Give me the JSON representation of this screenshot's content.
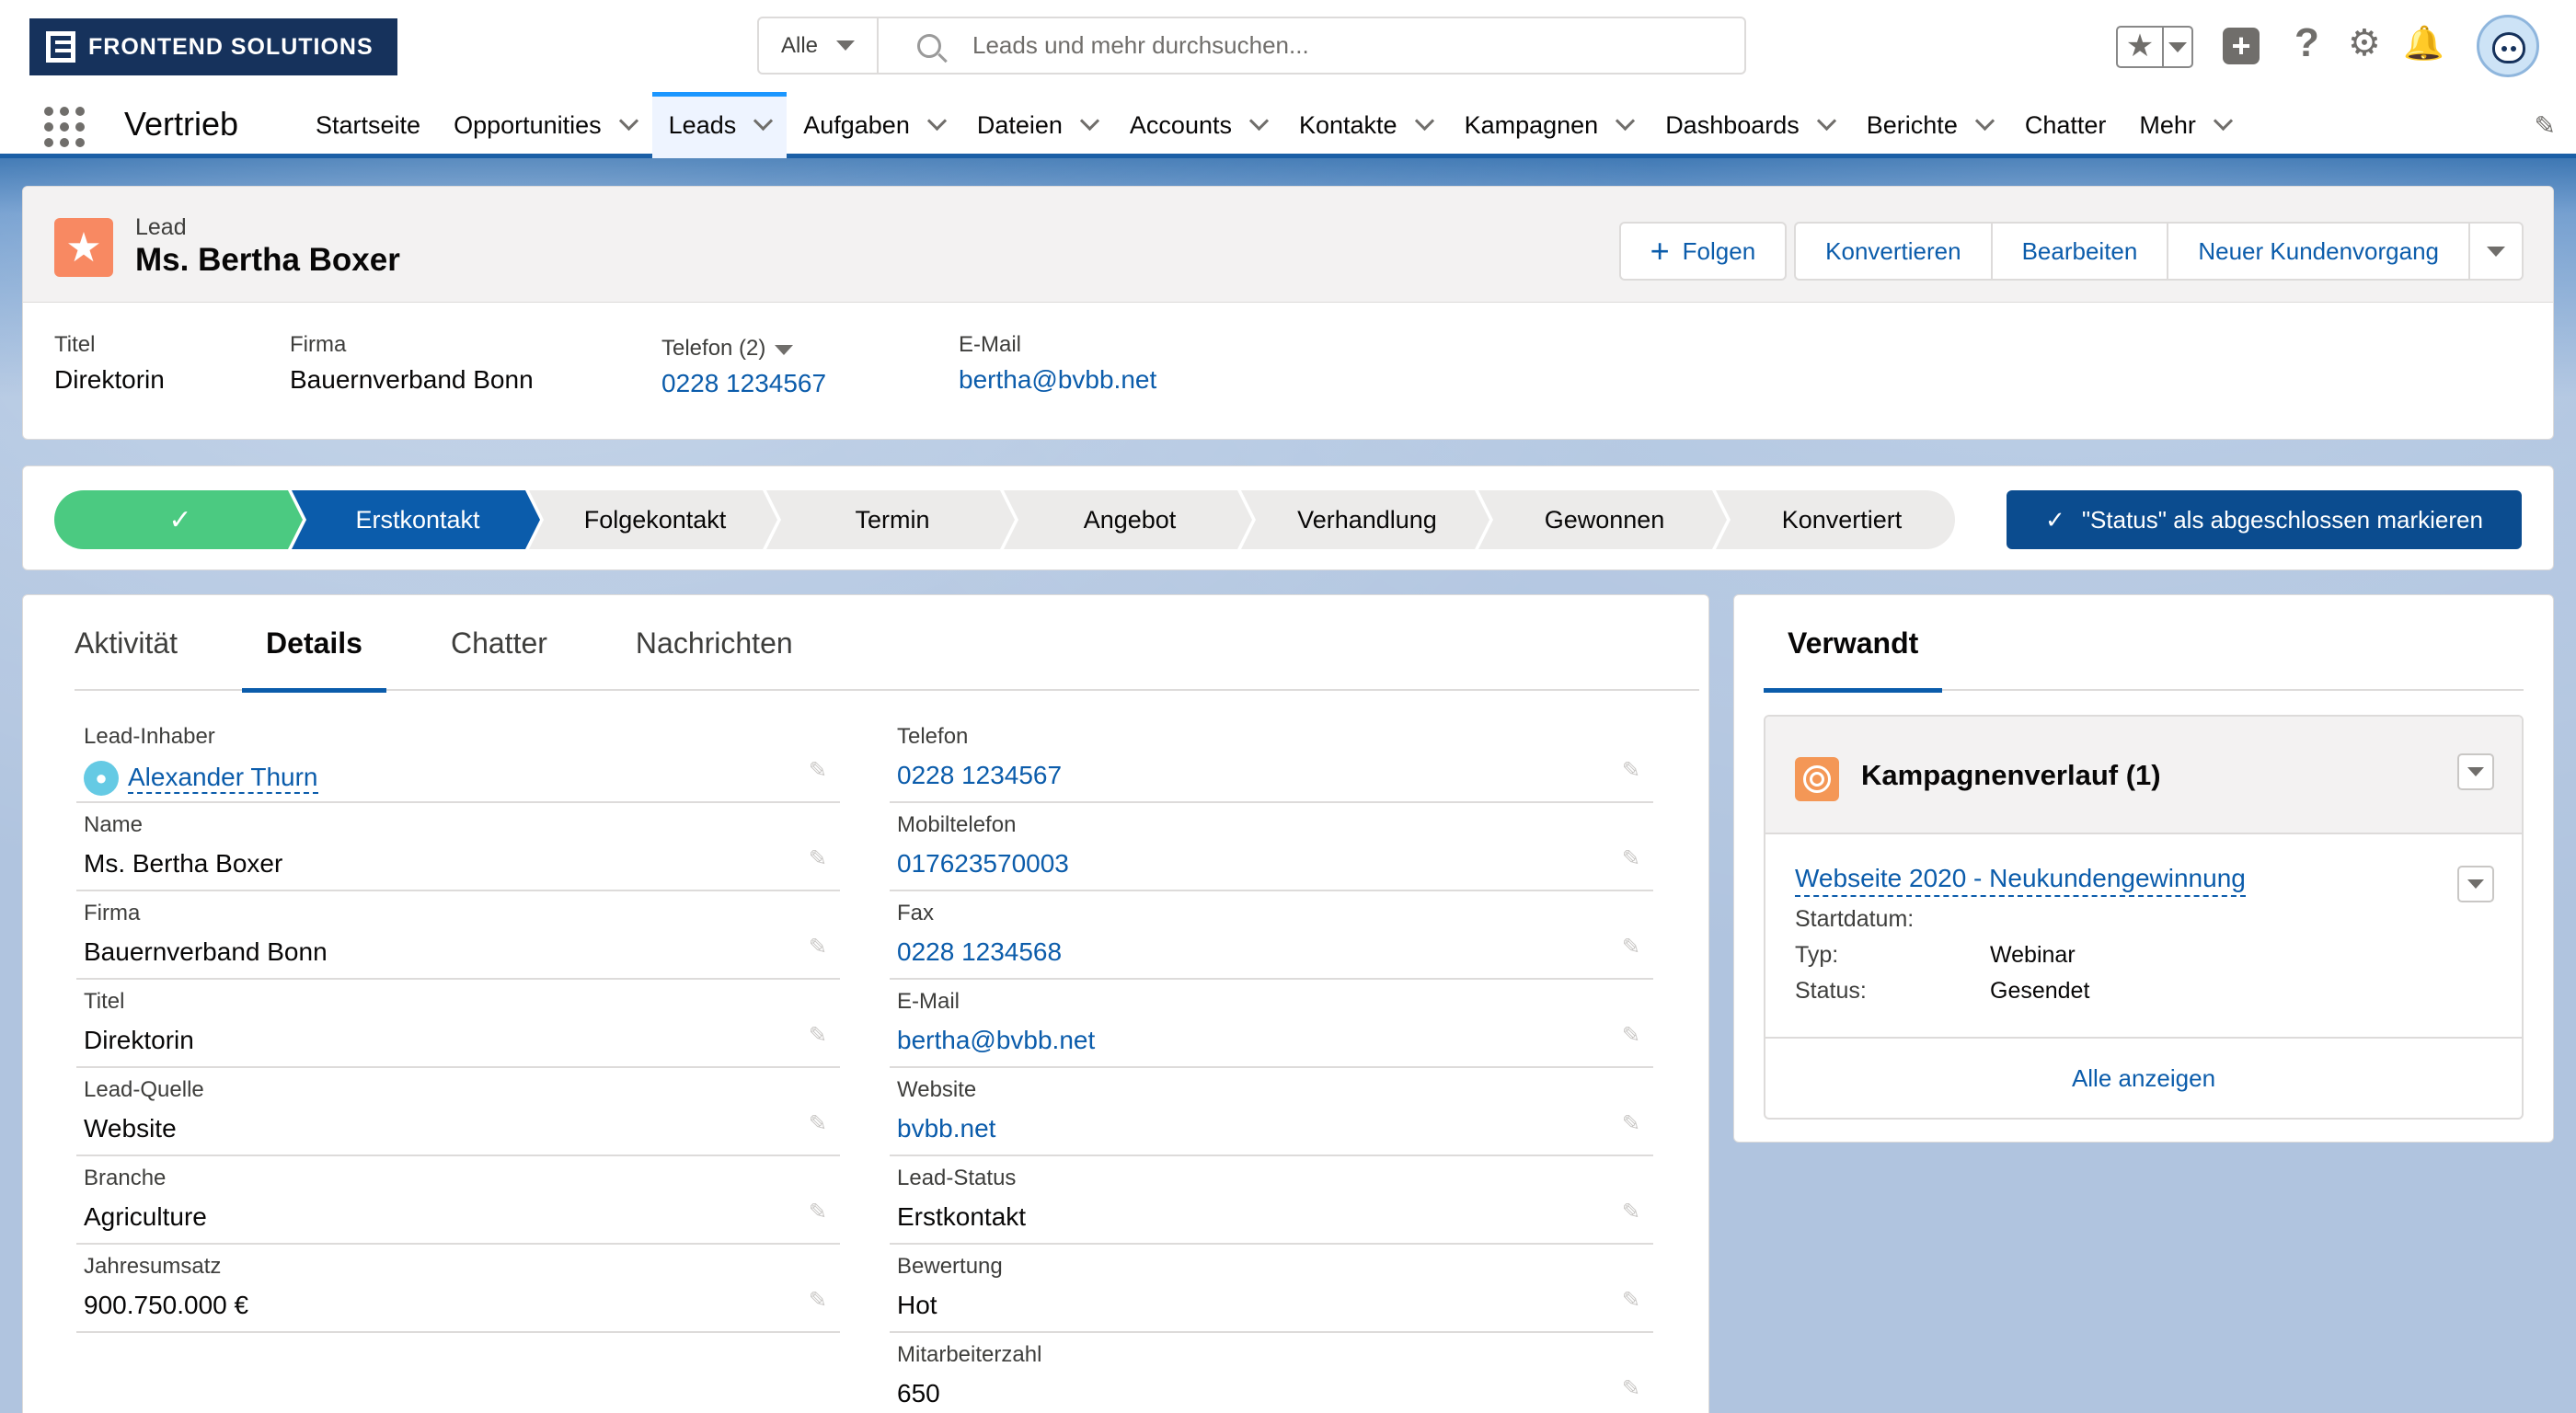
{
  "header": {
    "logo_text": "FRONTEND SOLUTIONS",
    "search_scope": "Alle",
    "search_placeholder": "Leads und mehr durchsuchen..."
  },
  "nav": {
    "app_name": "Vertrieb",
    "items": [
      {
        "label": "Startseite",
        "dropdown": false,
        "active": false
      },
      {
        "label": "Opportunities",
        "dropdown": true,
        "active": false
      },
      {
        "label": "Leads",
        "dropdown": true,
        "active": true
      },
      {
        "label": "Aufgaben",
        "dropdown": true,
        "active": false
      },
      {
        "label": "Dateien",
        "dropdown": true,
        "active": false
      },
      {
        "label": "Accounts",
        "dropdown": true,
        "active": false
      },
      {
        "label": "Kontakte",
        "dropdown": true,
        "active": false
      },
      {
        "label": "Kampagnen",
        "dropdown": true,
        "active": false
      },
      {
        "label": "Dashboards",
        "dropdown": true,
        "active": false
      },
      {
        "label": "Berichte",
        "dropdown": true,
        "active": false
      },
      {
        "label": "Chatter",
        "dropdown": false,
        "active": false
      },
      {
        "label": "Mehr",
        "dropdown": true,
        "active": false
      }
    ]
  },
  "record": {
    "entity": "Lead",
    "name": "Ms. Bertha Boxer",
    "actions": {
      "follow": "Folgen",
      "convert": "Konvertieren",
      "edit": "Bearbeiten",
      "new_case": "Neuer Kundenvorgang"
    },
    "highlights": [
      {
        "label": "Titel",
        "value": "Direktorin",
        "link": false
      },
      {
        "label": "Firma",
        "value": "Bauernverband Bonn",
        "link": false
      },
      {
        "label": "Telefon (2)",
        "value": "0228 1234567",
        "link": true
      },
      {
        "label": "E-Mail",
        "value": "bertha@bvbb.net",
        "link": true
      }
    ]
  },
  "path": {
    "stages": [
      {
        "label": "",
        "state": "complete"
      },
      {
        "label": "Erstkontakt",
        "state": "current"
      },
      {
        "label": "Folgekontakt",
        "state": "incomplete"
      },
      {
        "label": "Termin",
        "state": "incomplete"
      },
      {
        "label": "Angebot",
        "state": "incomplete"
      },
      {
        "label": "Verhandlung",
        "state": "incomplete"
      },
      {
        "label": "Gewonnen",
        "state": "incomplete"
      },
      {
        "label": "Konvertiert",
        "state": "incomplete"
      }
    ],
    "mark_complete": "\"Status\" als abgeschlossen markieren",
    "colors": {
      "complete": "#4bca81",
      "current": "#0b5cab",
      "incomplete": "#ecebea"
    }
  },
  "detail": {
    "tabs": [
      "Aktivität",
      "Details",
      "Chatter",
      "Nachrichten"
    ],
    "active_tab": "Details",
    "left": [
      {
        "label": "Lead-Inhaber",
        "value": "Alexander Thurn",
        "link": true
      },
      {
        "label": "Name",
        "value": "Ms. Bertha Boxer",
        "link": false
      },
      {
        "label": "Firma",
        "value": "Bauernverband Bonn",
        "link": false
      },
      {
        "label": "Titel",
        "value": "Direktorin",
        "link": false
      },
      {
        "label": "Lead-Quelle",
        "value": "Website",
        "link": false
      },
      {
        "label": "Branche",
        "value": "Agriculture",
        "link": false
      },
      {
        "label": "Jahresumsatz",
        "value": "900.750.000 €",
        "link": false
      }
    ],
    "right": [
      {
        "label": "Telefon",
        "value": "0228 1234567",
        "link": true
      },
      {
        "label": "Mobiltelefon",
        "value": "017623570003",
        "link": true
      },
      {
        "label": "Fax",
        "value": "0228 1234568",
        "link": true
      },
      {
        "label": "E-Mail",
        "value": "bertha@bvbb.net",
        "link": true
      },
      {
        "label": "Website",
        "value": "bvbb.net",
        "link": true
      },
      {
        "label": "Lead-Status",
        "value": "Erstkontakt",
        "link": false
      },
      {
        "label": "Bewertung",
        "value": "Hot",
        "link": false
      },
      {
        "label": "Mitarbeiterzahl",
        "value": "650",
        "link": false
      }
    ]
  },
  "related": {
    "tab": "Verwandt",
    "list_title": "Kampagnenverlauf (1)",
    "item": {
      "name": "Webseite 2020 - Neukundengewinnung",
      "rows": [
        {
          "k": "Startdatum:",
          "v": ""
        },
        {
          "k": "Typ:",
          "v": "Webinar"
        },
        {
          "k": "Status:",
          "v": "Gesendet"
        }
      ]
    },
    "view_all": "Alle anzeigen"
  },
  "icons": [
    "search-icon",
    "star-icon",
    "plus-icon",
    "help-icon",
    "gear-icon",
    "bell-icon",
    "avatar",
    "app-launcher-icon",
    "pencil-icon",
    "lead-icon",
    "campaign-icon",
    "check-icon",
    "user-icon"
  ]
}
